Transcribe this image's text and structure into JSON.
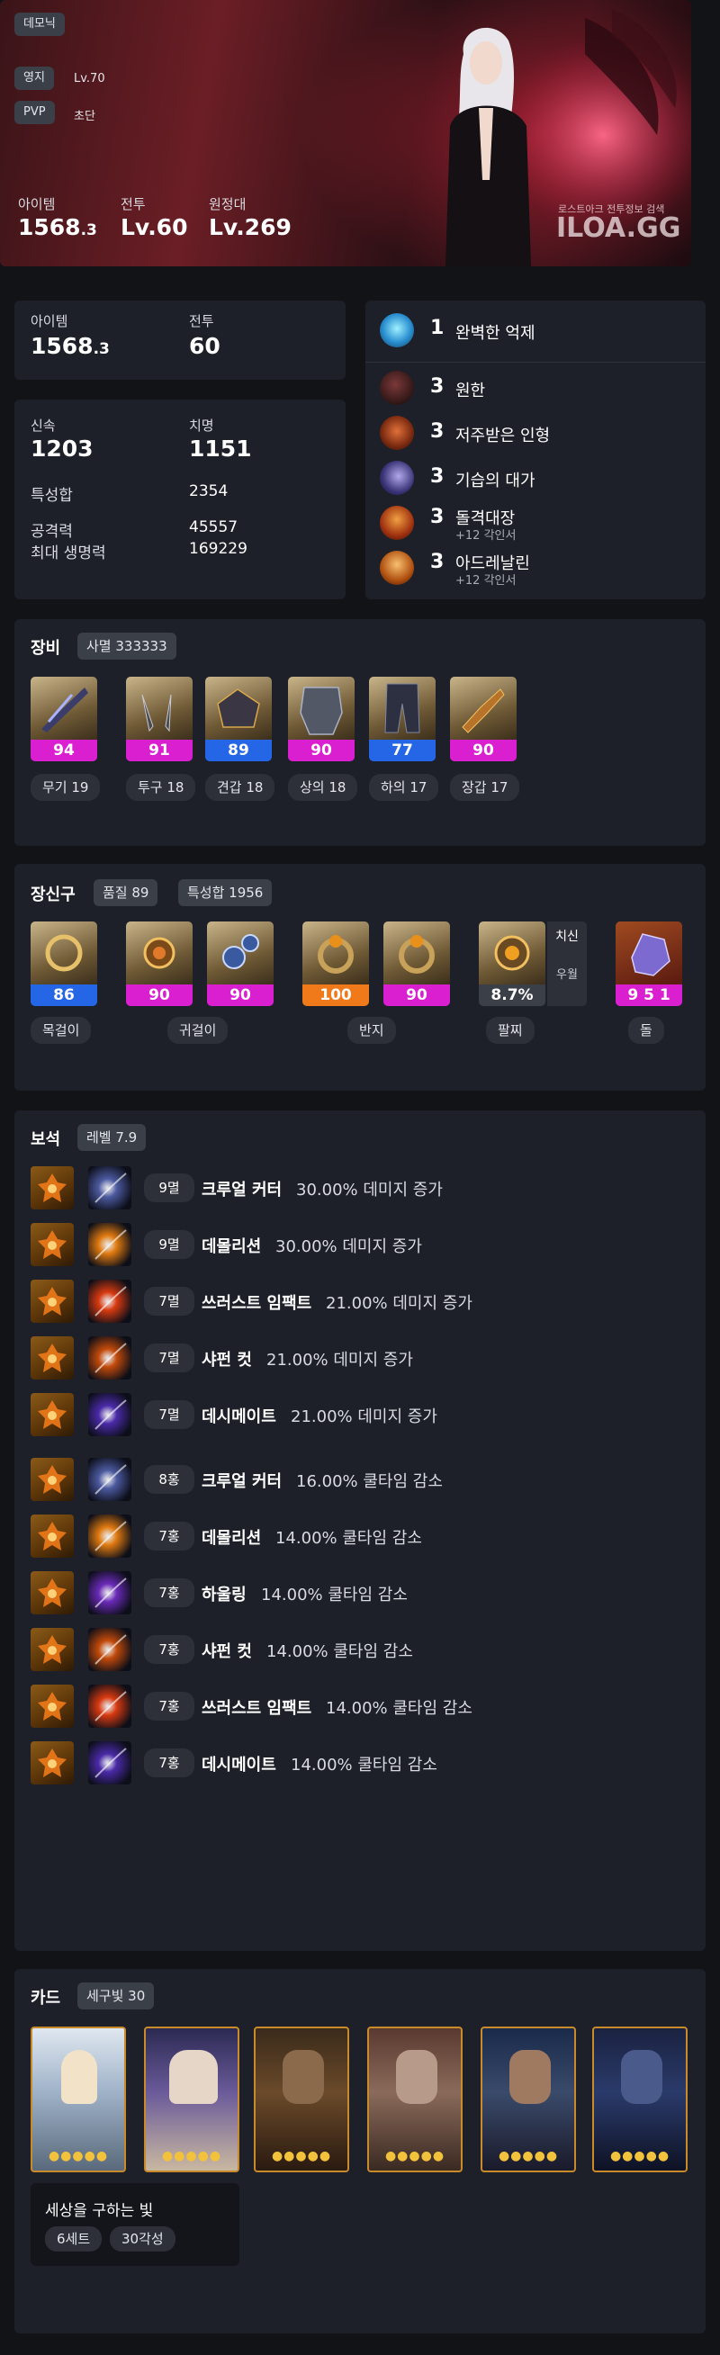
{
  "hero": {
    "class_tag": "데모닉",
    "territory_label": "영지",
    "territory_level": "Lv.70",
    "pvp_label": "PVP",
    "pvp_rank": "초단",
    "item_label": "아이템",
    "item_value": "1568",
    "item_decimal": ".3",
    "battle_label": "전투",
    "battle_value": "Lv.60",
    "expedition_label": "원정대",
    "expedition_value": "Lv.269",
    "brand_sub": "로스트아크 전투정보 검색",
    "brand": "ILOA.GG"
  },
  "summary": {
    "item_label": "아이템",
    "item_value": "1568",
    "item_decimal": ".3",
    "battle_label": "전투",
    "battle_value": "60"
  },
  "stats": {
    "swift_label": "신속",
    "swift_value": "1203",
    "crit_label": "치명",
    "crit_value": "1151",
    "total_label": "특성합",
    "total_value": "2354",
    "atk_label": "공격력",
    "atk_value": "45557",
    "hp_label": "최대 생명력",
    "hp_value": "169229"
  },
  "engravings": [
    {
      "count": "1",
      "name": "완벽한 억제",
      "sub": "",
      "icon": "perfect-suppression-icon"
    },
    {
      "count": "3",
      "name": "원한",
      "sub": "",
      "icon": "grudge-icon"
    },
    {
      "count": "3",
      "name": "저주받은 인형",
      "sub": "",
      "icon": "cursed-doll-icon"
    },
    {
      "count": "3",
      "name": "기습의 대가",
      "sub": "",
      "icon": "master-ambush-icon"
    },
    {
      "count": "3",
      "name": "돌격대장",
      "sub": "+12 각인서",
      "icon": "raid-captain-icon"
    },
    {
      "count": "3",
      "name": "아드레날린",
      "sub": "+12 각인서",
      "icon": "adrenaline-icon"
    }
  ],
  "equipment": {
    "title": "장비",
    "set_badge": "사멸 333333",
    "items": [
      {
        "quality": "94",
        "label": "무기 19",
        "color": "#d91fd0",
        "icon": "weapon-icon"
      },
      {
        "quality": "91",
        "label": "투구 18",
        "color": "#d91fd0",
        "icon": "helmet-icon"
      },
      {
        "quality": "89",
        "label": "견갑 18",
        "color": "#2466e6",
        "icon": "shoulder-icon"
      },
      {
        "quality": "90",
        "label": "상의 18",
        "color": "#d91fd0",
        "icon": "chest-icon"
      },
      {
        "quality": "77",
        "label": "하의 17",
        "color": "#2466e6",
        "icon": "pants-icon"
      },
      {
        "quality": "90",
        "label": "장갑 17",
        "color": "#d91fd0",
        "icon": "gloves-icon"
      }
    ]
  },
  "accessories": {
    "title": "장신구",
    "quality_badge": "품질 89",
    "stat_badge": "특성합 1956",
    "items": [
      {
        "value": "86",
        "color": "#2466e6",
        "icon": "necklace-icon"
      },
      {
        "value": "90",
        "color": "#d91fd0",
        "icon": "earring-icon"
      },
      {
        "value": "90",
        "color": "#d91fd0",
        "icon": "earring-icon"
      },
      {
        "value": "100",
        "color": "#f07a1a",
        "icon": "ring-icon"
      },
      {
        "value": "90",
        "color": "#d91fd0",
        "icon": "ring-icon"
      },
      {
        "value": "8.7%",
        "color": "#3b3f48",
        "icon": "bracelet-icon"
      },
      {
        "value": "9 5 1",
        "color": "#d91fd0",
        "icon": "stone-icon"
      }
    ],
    "bracelet_stat": "치신",
    "bracelet_grade": "우월",
    "labels": [
      "목걸이",
      "귀걸이",
      "반지",
      "팔찌",
      "돌"
    ]
  },
  "gems": {
    "title": "보석",
    "level_badge": "레벨 7.9",
    "items": [
      {
        "level": "9멸",
        "skill": "크루얼 커터",
        "effect": "30.00% 데미지 증가",
        "skill_icon": "cruel-cutter-icon",
        "skill_color": "#4c5aa0"
      },
      {
        "level": "9멸",
        "skill": "데몰리션",
        "effect": "30.00% 데미지 증가",
        "skill_icon": "demolition-icon",
        "skill_color": "#e07a10"
      },
      {
        "level": "7멸",
        "skill": "쓰러스트 임팩트",
        "effect": "21.00% 데미지 증가",
        "skill_icon": "thrust-impact-icon",
        "skill_color": "#d83a10"
      },
      {
        "level": "7멸",
        "skill": "샤펀 컷",
        "effect": "21.00% 데미지 증가",
        "skill_icon": "sharpen-cut-icon",
        "skill_color": "#c24a0a"
      },
      {
        "level": "7멸",
        "skill": "데시메이트",
        "effect": "21.00% 데미지 증가",
        "skill_icon": "decimate-icon",
        "skill_color": "#4a2aa8"
      },
      {
        "level": "8홍",
        "skill": "크루얼 커터",
        "effect": "16.00% 쿨타임 감소",
        "skill_icon": "cruel-cutter-icon",
        "skill_color": "#4c5aa0"
      },
      {
        "level": "7홍",
        "skill": "데몰리션",
        "effect": "14.00% 쿨타임 감소",
        "skill_icon": "demolition-icon",
        "skill_color": "#e07a10"
      },
      {
        "level": "7홍",
        "skill": "하울링",
        "effect": "14.00% 쿨타임 감소",
        "skill_icon": "howling-icon",
        "skill_color": "#6a2ab8"
      },
      {
        "level": "7홍",
        "skill": "샤펀 컷",
        "effect": "14.00% 쿨타임 감소",
        "skill_icon": "sharpen-cut-icon",
        "skill_color": "#c24a0a"
      },
      {
        "level": "7홍",
        "skill": "쓰러스트 임팩트",
        "effect": "14.00% 쿨타임 감소",
        "skill_icon": "thrust-impact-icon",
        "skill_color": "#d83a10"
      },
      {
        "level": "7홍",
        "skill": "데시메이트",
        "effect": "14.00% 쿨타임 감소",
        "skill_icon": "decimate-icon",
        "skill_color": "#4a2aa8"
      }
    ]
  },
  "cards": {
    "title": "카드",
    "set_badge": "세구빛 30",
    "items": [
      {
        "icon": "card-kadan-icon",
        "stars": "●●●●●"
      },
      {
        "icon": "card-ninave-icon",
        "stars": "●●●●●"
      },
      {
        "icon": "card-azena-icon",
        "stars": "●●●●●"
      },
      {
        "icon": "card-shandi-icon",
        "stars": "●●●●●"
      },
      {
        "icon": "card-bahuntur-icon",
        "stars": "●●●●●"
      },
      {
        "icon": "card-silian-icon",
        "stars": "●●●●●"
      }
    ],
    "set_name": "세상을 구하는 빛",
    "set_count": "6세트",
    "awakening": "30각성"
  }
}
